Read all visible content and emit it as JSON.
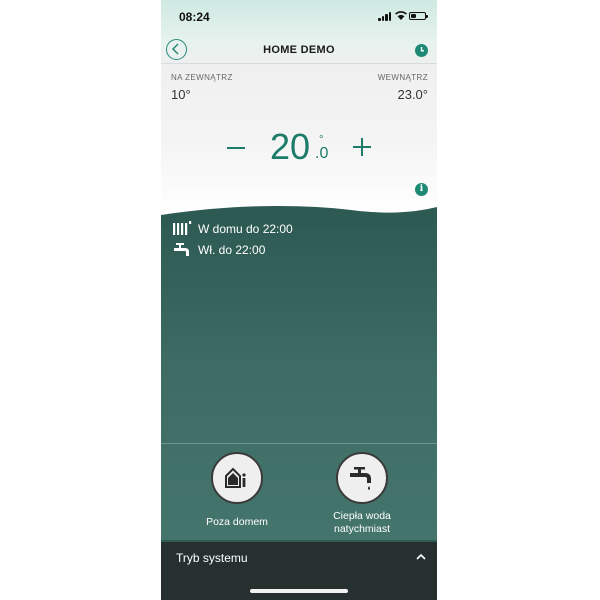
{
  "status_bar": {
    "time": "08:24"
  },
  "header": {
    "title": "HOME DEMO"
  },
  "outside": {
    "label": "NA ZEWNĄTRZ",
    "value": "10°"
  },
  "inside": {
    "label": "WEWNĄTRZ",
    "value": "23.0°"
  },
  "setpoint": {
    "integer": "20",
    "degree": "°",
    "decimal": ".0"
  },
  "status_rows": [
    {
      "icon": "radiator-icon",
      "text": "W domu do 22:00"
    },
    {
      "icon": "tap-icon",
      "text": "Wł. do 22:00"
    }
  ],
  "quick_actions": [
    {
      "icon": "away-home-icon",
      "label": "Poza domem"
    },
    {
      "icon": "hot-water-tap-icon",
      "label_line1": "Ciepła woda",
      "label_line2": "natychmiast"
    }
  ],
  "footer": {
    "label": "Tryb systemu"
  },
  "colors": {
    "accent": "#1d7c69",
    "dark_green": "#2f5b54",
    "footer": "#26312f"
  }
}
